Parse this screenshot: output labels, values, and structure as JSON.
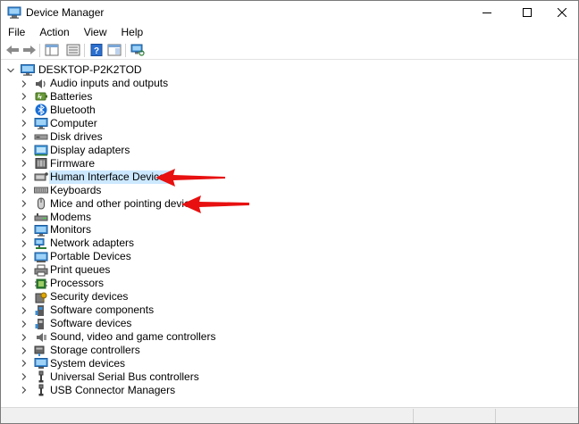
{
  "window": {
    "title": "Device Manager",
    "app_icon": "device-manager-icon",
    "controls": [
      "minimize-icon",
      "maximize-icon",
      "close-icon"
    ]
  },
  "menubar": {
    "items": [
      "File",
      "Action",
      "View",
      "Help"
    ]
  },
  "toolbar": {
    "buttons": [
      "back-arrow-icon",
      "forward-arrow-icon",
      "properties-grid-icon",
      "show-hide-console-icon",
      "help-icon",
      "action-pane-icon",
      "scan-hardware-icon"
    ]
  },
  "tree": {
    "root": {
      "label": "DESKTOP-P2K2TOD",
      "icon": "computer-icon",
      "expanded": true
    },
    "nodes": [
      {
        "label": "Audio inputs and outputs",
        "icon": "speaker-icon"
      },
      {
        "label": "Batteries",
        "icon": "battery-icon"
      },
      {
        "label": "Bluetooth",
        "icon": "bluetooth-icon"
      },
      {
        "label": "Computer",
        "icon": "monitor-icon"
      },
      {
        "label": "Disk drives",
        "icon": "disk-drive-icon"
      },
      {
        "label": "Display adapters",
        "icon": "display-adapter-icon"
      },
      {
        "label": "Firmware",
        "icon": "firmware-icon"
      },
      {
        "label": "Human Interface Devices",
        "icon": "hid-icon",
        "selected": true
      },
      {
        "label": "Keyboards",
        "icon": "keyboard-icon"
      },
      {
        "label": "Mice and other pointing devices",
        "icon": "mouse-icon"
      },
      {
        "label": "Modems",
        "icon": "modem-icon"
      },
      {
        "label": "Monitors",
        "icon": "monitor-icon"
      },
      {
        "label": "Network adapters",
        "icon": "network-adapter-icon"
      },
      {
        "label": "Portable Devices",
        "icon": "portable-device-icon"
      },
      {
        "label": "Print queues",
        "icon": "printer-icon"
      },
      {
        "label": "Processors",
        "icon": "processor-icon"
      },
      {
        "label": "Security devices",
        "icon": "security-device-icon"
      },
      {
        "label": "Software components",
        "icon": "software-component-icon"
      },
      {
        "label": "Software devices",
        "icon": "software-device-icon"
      },
      {
        "label": "Sound, video and game controllers",
        "icon": "sound-controller-icon"
      },
      {
        "label": "Storage controllers",
        "icon": "storage-controller-icon"
      },
      {
        "label": "System devices",
        "icon": "system-device-icon"
      },
      {
        "label": "Universal Serial Bus controllers",
        "icon": "usb-icon"
      },
      {
        "label": "USB Connector Managers",
        "icon": "usb-icon"
      }
    ]
  },
  "annotations": {
    "arrow_color": "#e81010",
    "arrows": [
      "red-arrow-icon",
      "red-arrow-icon"
    ]
  },
  "colors": {
    "selection": "#cce8ff",
    "accent_blue": "#2b7cd3"
  }
}
